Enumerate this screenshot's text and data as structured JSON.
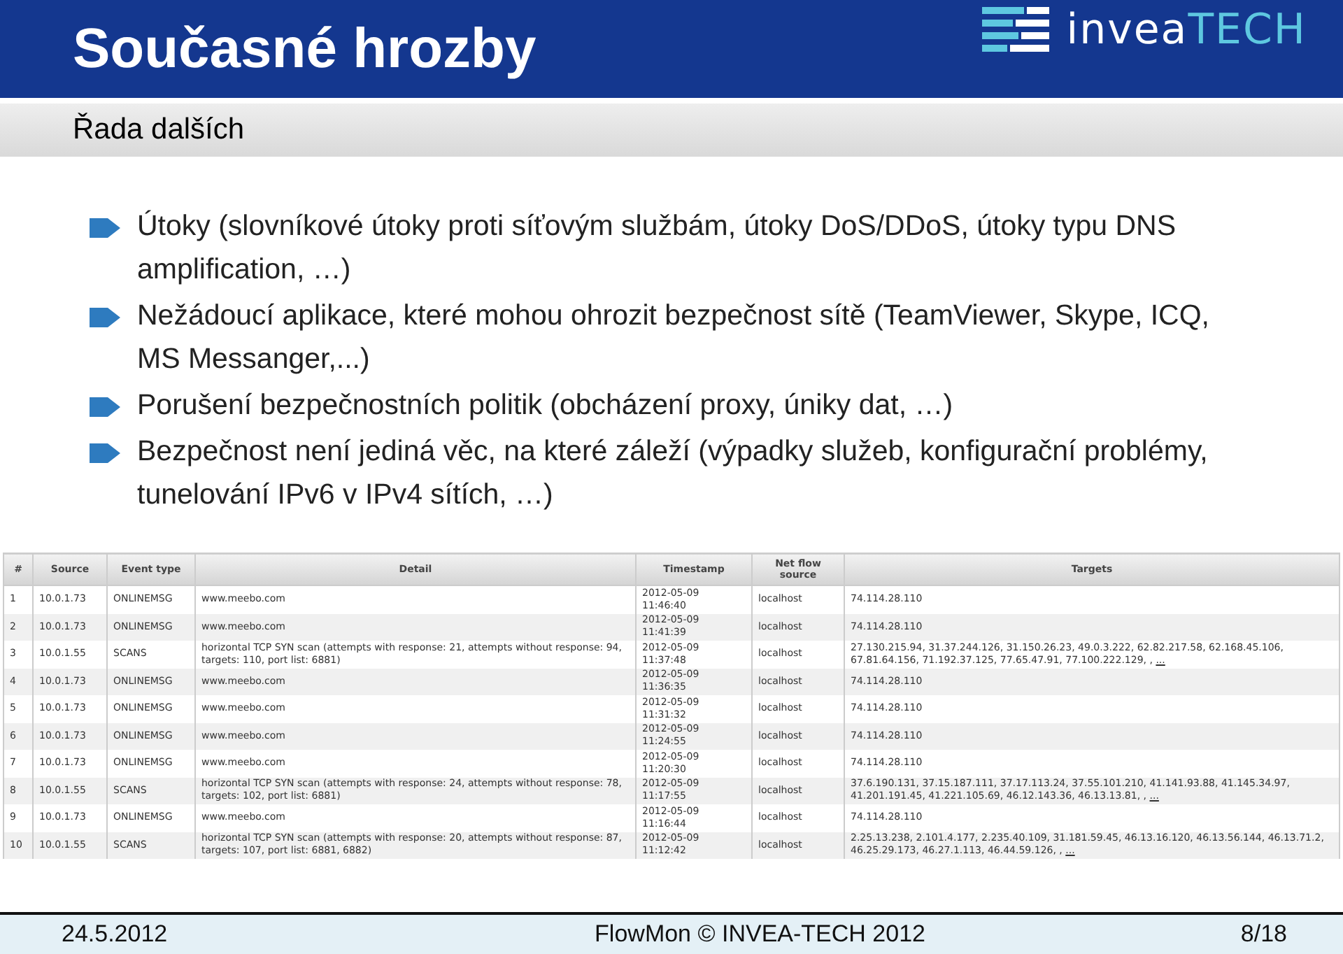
{
  "header": {
    "title": "Současné hrozby",
    "logo": {
      "text_1": "invea",
      "text_2": "TECH"
    }
  },
  "subtitle": "Řada dalších",
  "bullets": [
    "Útoky (slovníkové útoky proti síťovým službám, útoky DoS/DDoS, útoky typu DNS amplification, …)",
    "Nežádoucí aplikace, které mohou ohrozit bezpečnost sítě (TeamViewer, Skype, ICQ, MS Messanger,...)",
    "Porušení bezpečnostních politik (obcházení proxy, úniky dat, …)",
    "Bezpečnost není jediná věc, na které záleží (výpadky služeb, konfigurační problémy, tunelování IPv6 v IPv4 sítích, …)"
  ],
  "table": {
    "columns": [
      "#",
      "Source",
      "Event type",
      "Detail",
      "Timestamp",
      "Net flow source",
      "Targets"
    ],
    "rows": [
      {
        "cells": [
          "1",
          "10.0.1.73",
          "ONLINEMSG",
          "www.meebo.com",
          "2012-05-09 11:46:40",
          "localhost",
          "74.114.28.110"
        ]
      },
      {
        "cells": [
          "2",
          "10.0.1.73",
          "ONLINEMSG",
          "www.meebo.com",
          "2012-05-09 11:41:39",
          "localhost",
          "74.114.28.110"
        ]
      },
      {
        "cells": [
          "3",
          "10.0.1.55",
          "SCANS",
          "horizontal TCP SYN scan (attempts with response: 21, attempts without response: 94, targets: 110, port list: 6881)",
          "2012-05-09 11:37:48",
          "localhost",
          "27.130.215.94, 31.37.244.126, 31.150.26.23, 49.0.3.222, 62.82.217.58, 62.168.45.106, 67.81.64.156, 71.192.37.125, 77.65.47.91, 77.100.222.129, ,"
        ],
        "more_link": "..."
      },
      {
        "cells": [
          "4",
          "10.0.1.73",
          "ONLINEMSG",
          "www.meebo.com",
          "2012-05-09 11:36:35",
          "localhost",
          "74.114.28.110"
        ]
      },
      {
        "cells": [
          "5",
          "10.0.1.73",
          "ONLINEMSG",
          "www.meebo.com",
          "2012-05-09 11:31:32",
          "localhost",
          "74.114.28.110"
        ]
      },
      {
        "cells": [
          "6",
          "10.0.1.73",
          "ONLINEMSG",
          "www.meebo.com",
          "2012-05-09 11:24:55",
          "localhost",
          "74.114.28.110"
        ]
      },
      {
        "cells": [
          "7",
          "10.0.1.73",
          "ONLINEMSG",
          "www.meebo.com",
          "2012-05-09 11:20:30",
          "localhost",
          "74.114.28.110"
        ]
      },
      {
        "cells": [
          "8",
          "10.0.1.55",
          "SCANS",
          "horizontal TCP SYN scan (attempts with response: 24, attempts without response: 78, targets: 102, port list: 6881)",
          "2012-05-09 11:17:55",
          "localhost",
          "37.6.190.131, 37.15.187.111, 37.17.113.24, 37.55.101.210, 41.141.93.88, 41.145.34.97, 41.201.191.45, 41.221.105.69, 46.12.143.36, 46.13.13.81, ,"
        ],
        "more_link": "..."
      },
      {
        "cells": [
          "9",
          "10.0.1.73",
          "ONLINEMSG",
          "www.meebo.com",
          "2012-05-09 11:16:44",
          "localhost",
          "74.114.28.110"
        ]
      },
      {
        "cells": [
          "10",
          "10.0.1.55",
          "SCANS",
          "horizontal TCP SYN scan (attempts with response: 20, attempts without response: 87, targets: 107, port list: 6881, 6882)",
          "2012-05-09 11:12:42",
          "localhost",
          "2.25.13.238, 2.101.4.177, 2.235.40.109, 31.181.59.45, 46.13.16.120, 46.13.56.144, 46.13.71.2, 46.25.29.173, 46.27.1.113, 46.44.59.126, ,"
        ],
        "more_link": "..."
      }
    ]
  },
  "footer": {
    "date": "24.5.2012",
    "center": "FlowMon © INVEA-TECH 2012",
    "page": "8/18"
  }
}
